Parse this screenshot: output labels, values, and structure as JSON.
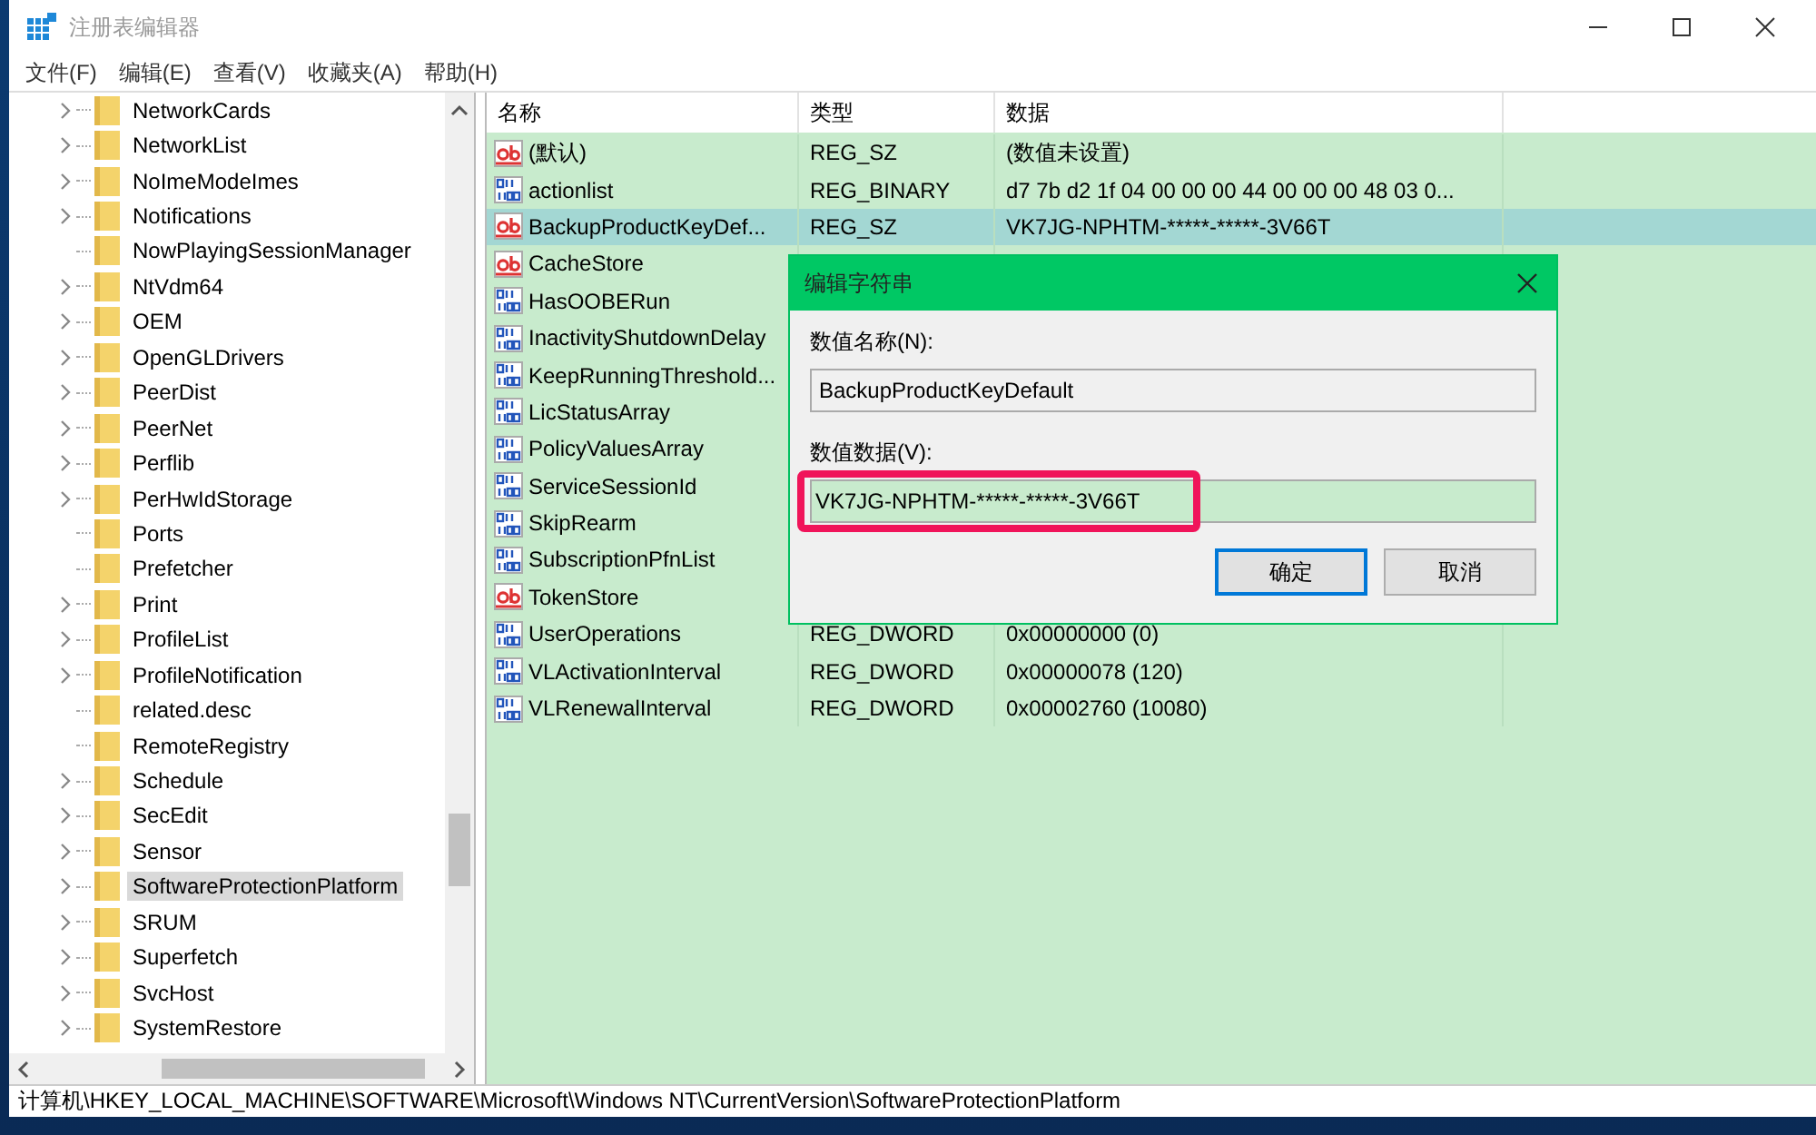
{
  "window": {
    "title": "注册表编辑器"
  },
  "menu": [
    "文件(F)",
    "编辑(E)",
    "查看(V)",
    "收藏夹(A)",
    "帮助(H)"
  ],
  "tree": [
    {
      "label": "NetworkCards",
      "expandable": true,
      "selected": false
    },
    {
      "label": "NetworkList",
      "expandable": true,
      "selected": false
    },
    {
      "label": "NoImeModeImes",
      "expandable": true,
      "selected": false
    },
    {
      "label": "Notifications",
      "expandable": true,
      "selected": false
    },
    {
      "label": "NowPlayingSessionManager",
      "expandable": false,
      "selected": false
    },
    {
      "label": "NtVdm64",
      "expandable": true,
      "selected": false
    },
    {
      "label": "OEM",
      "expandable": true,
      "selected": false
    },
    {
      "label": "OpenGLDrivers",
      "expandable": true,
      "selected": false
    },
    {
      "label": "PeerDist",
      "expandable": true,
      "selected": false
    },
    {
      "label": "PeerNet",
      "expandable": true,
      "selected": false
    },
    {
      "label": "Perflib",
      "expandable": true,
      "selected": false
    },
    {
      "label": "PerHwIdStorage",
      "expandable": true,
      "selected": false
    },
    {
      "label": "Ports",
      "expandable": false,
      "selected": false
    },
    {
      "label": "Prefetcher",
      "expandable": false,
      "selected": false
    },
    {
      "label": "Print",
      "expandable": true,
      "selected": false
    },
    {
      "label": "ProfileList",
      "expandable": true,
      "selected": false
    },
    {
      "label": "ProfileNotification",
      "expandable": true,
      "selected": false
    },
    {
      "label": "related.desc",
      "expandable": false,
      "selected": false
    },
    {
      "label": "RemoteRegistry",
      "expandable": false,
      "selected": false
    },
    {
      "label": "Schedule",
      "expandable": true,
      "selected": false
    },
    {
      "label": "SecEdit",
      "expandable": true,
      "selected": false
    },
    {
      "label": "Sensor",
      "expandable": true,
      "selected": false
    },
    {
      "label": "SoftwareProtectionPlatform",
      "expandable": true,
      "selected": true
    },
    {
      "label": "SRUM",
      "expandable": true,
      "selected": false
    },
    {
      "label": "Superfetch",
      "expandable": true,
      "selected": false
    },
    {
      "label": "SvcHost",
      "expandable": true,
      "selected": false
    },
    {
      "label": "SystemRestore",
      "expandable": true,
      "selected": false
    }
  ],
  "table": {
    "columns": [
      "名称",
      "类型",
      "数据"
    ],
    "rows": [
      {
        "kind": "string",
        "name": "(默认)",
        "type": "REG_SZ",
        "data": "(数值未设置)",
        "selected": false
      },
      {
        "kind": "binary",
        "name": "actionlist",
        "type": "REG_BINARY",
        "data": "d7 7b d2 1f 04 00 00 00 44 00 00 00 48 03 0...",
        "selected": false
      },
      {
        "kind": "string",
        "name": "BackupProductKeyDef...",
        "type": "REG_SZ",
        "data": "VK7JG-NPHTM-*****-*****-3V66T",
        "selected": true
      },
      {
        "kind": "string",
        "name": "CacheStore",
        "selected": false
      },
      {
        "kind": "binary",
        "name": "HasOOBERun",
        "selected": false
      },
      {
        "kind": "binary",
        "name": "InactivityShutdownDelay",
        "selected": false
      },
      {
        "kind": "binary",
        "name": "KeepRunningThreshold...",
        "selected": false
      },
      {
        "kind": "binary",
        "name": "LicStatusArray",
        "selected": false
      },
      {
        "kind": "binary",
        "name": "PolicyValuesArray",
        "selected": false
      },
      {
        "kind": "binary",
        "name": "ServiceSessionId",
        "selected": false
      },
      {
        "kind": "binary",
        "name": "SkipRearm",
        "selected": false
      },
      {
        "kind": "binary",
        "name": "SubscriptionPfnList",
        "selected": false
      },
      {
        "kind": "string",
        "name": "TokenStore",
        "selected": false
      },
      {
        "kind": "binary",
        "name": "UserOperations",
        "type": "REG_DWORD",
        "data": "0x00000000 (0)",
        "selected": false
      },
      {
        "kind": "binary",
        "name": "VLActivationInterval",
        "type": "REG_DWORD",
        "data": "0x00000078 (120)",
        "selected": false
      },
      {
        "kind": "binary",
        "name": "VLRenewalInterval",
        "type": "REG_DWORD",
        "data": "0x00002760 (10080)",
        "selected": false
      }
    ]
  },
  "dialog": {
    "title": "编辑字符串",
    "name_label": "数值名称(N):",
    "name_value": "BackupProductKeyDefault",
    "data_label": "数值数据(V):",
    "data_value": "VK7JG-NPHTM-*****-*****-3V66T",
    "buttons": [
      {
        "label": "确定",
        "default": true
      },
      {
        "label": "取消",
        "default": false
      }
    ]
  },
  "status_bar": "计算机\\HKEY_LOCAL_MACHINE\\SOFTWARE\\Microsoft\\Windows NT\\CurrentVersion\\SoftwareProtectionPlatform"
}
